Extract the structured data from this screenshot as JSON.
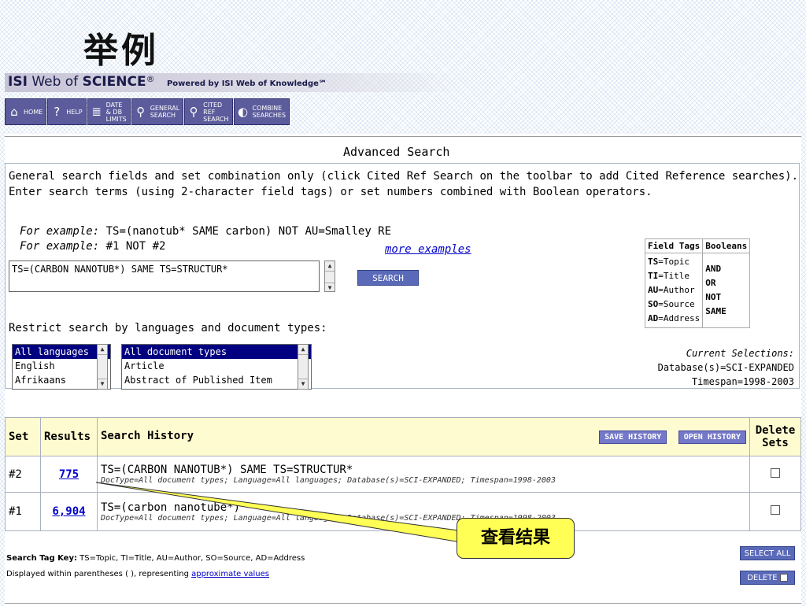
{
  "slide": {
    "title": "举例"
  },
  "header": {
    "isi": "ISI",
    "web_of": "Web of",
    "science": "SCIENCE",
    "reg": "®",
    "powered": "Powered by ISI Web of Knowledge℠"
  },
  "toolbar": [
    {
      "label1": "HOME",
      "label2": "",
      "label3": "",
      "icon": "home-icon",
      "glyph": "⌂"
    },
    {
      "label1": "HELP",
      "label2": "",
      "label3": "",
      "icon": "help-icon",
      "glyph": "?"
    },
    {
      "label1": "DATE",
      "label2": "& DB",
      "label3": "LIMITS",
      "icon": "database-icon",
      "glyph": "≣"
    },
    {
      "label1": "GENERAL",
      "label2": "SEARCH",
      "label3": "",
      "icon": "search-icon",
      "glyph": "⚲"
    },
    {
      "label1": "CITED",
      "label2": "REF",
      "label3": "SEARCH",
      "icon": "cited-search-icon",
      "glyph": "⚲"
    },
    {
      "label1": "COMBINE",
      "label2": "SEARCHES",
      "label3": "",
      "icon": "combine-icon",
      "glyph": "◐"
    }
  ],
  "advanced": {
    "title": "Advanced Search",
    "intro1": "General search fields and set combination only (click Cited Ref Search on the toolbar to add Cited Reference searches).",
    "intro2": "Enter search terms (using 2-character field tags) or set numbers combined with Boolean operators.",
    "example_label": "For example:",
    "example1": "TS=(nanotub* SAME carbon) NOT AU=Smalley RE",
    "example2": "#1 NOT #2",
    "more_examples": "more examples",
    "query_value": "TS=(CARBON NANOTUB*) SAME TS=STRUCTUR*",
    "search_button": "SEARCH",
    "restrict_label": "Restrict search by languages and document types:",
    "languages": [
      "All languages",
      "English",
      "Afrikaans"
    ],
    "doc_types": [
      "All document types",
      "Article",
      "Abstract of Published Item"
    ],
    "current_selections": "Current Selections:",
    "database": "Database(s)=SCI-EXPANDED",
    "timespan": "Timespan=1998-2003"
  },
  "field_tags": {
    "header_tags": "Field Tags",
    "header_booleans": "Booleans",
    "tags": [
      {
        "code": "TS",
        "name": "=Topic"
      },
      {
        "code": "TI",
        "name": "=Title"
      },
      {
        "code": "AU",
        "name": "=Author"
      },
      {
        "code": "SO",
        "name": "=Source"
      },
      {
        "code": "AD",
        "name": "=Address"
      }
    ],
    "booleans": [
      "AND",
      "OR",
      "NOT",
      "SAME"
    ]
  },
  "history": {
    "col_set": "Set",
    "col_results": "Results",
    "col_search": "Search History",
    "save_button": "SAVE HISTORY",
    "open_button": "OPEN HISTORY",
    "col_delete1": "Delete",
    "col_delete2": "Sets",
    "rows": [
      {
        "set": "#2",
        "results": "775",
        "query": "TS=(CARBON NANOTUB*) SAME TS=STRUCTUR*",
        "detail": "DocType=All document types; Language=All languages; Database(s)=SCI-EXPANDED; Timespan=1998-2003"
      },
      {
        "set": "#1",
        "results": "6,904",
        "query": "TS=(carbon nanotube*)",
        "detail": "DocType=All document types; Language=All languages; Database(s)=SCI-EXPANDED; Timespan=1998-2003"
      }
    ]
  },
  "footer": {
    "key_label": "Search Tag Key:",
    "key_text": " TS=Topic, TI=Title, AU=Author, SO=Source, AD=Address",
    "displayed": "Displayed within parentheses ( ), representing ",
    "approx_link": "approximate values",
    "select_all": "SELECT ALL",
    "delete": "DELETE"
  },
  "callout": {
    "text": "查看结果"
  }
}
